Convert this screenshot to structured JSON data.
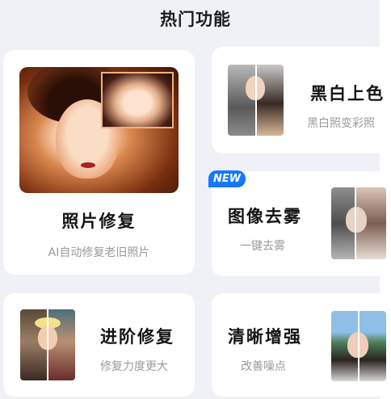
{
  "section": {
    "title": "热门功能"
  },
  "cards": {
    "photo_repair": {
      "title": "照片修复",
      "subtitle": "AI自动修复老旧照片"
    },
    "colorize": {
      "title": "黑白上色",
      "subtitle": "黑白照变彩照"
    },
    "dehaze": {
      "title": "图像去雾",
      "subtitle": "一键去雾",
      "badge": "NEW"
    },
    "advanced_repair": {
      "title": "进阶修复",
      "subtitle": "修复力度更大"
    },
    "sharpen": {
      "title": "清晰增强",
      "subtitle": "改善噪点"
    }
  },
  "colors": {
    "accent": "#1677ff",
    "background": "#eff1f6",
    "card": "#ffffff"
  }
}
